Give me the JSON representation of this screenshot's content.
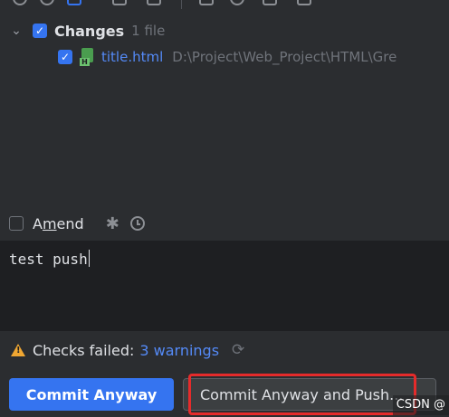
{
  "changes": {
    "group_label": "Changes",
    "group_count": "1 file",
    "file_name": "title.html",
    "file_path": "D:\\Project\\Web_Project\\HTML\\Gre",
    "file_icon_tag": "H"
  },
  "amend": {
    "label_prefix": "A",
    "label_underlined": "m",
    "label_rest": "end"
  },
  "commit_message": "test push",
  "checks": {
    "status": "Checks failed:",
    "warnings_link": "3 warnings"
  },
  "buttons": {
    "commit_anyway": "Commit Anyway",
    "commit_anyway_push": "Commit Anyway and Push..."
  },
  "watermark": "CSDN @",
  "colors": {
    "accent": "#3574f0",
    "warning": "#f0a732",
    "highlight": "#e52b2b"
  }
}
